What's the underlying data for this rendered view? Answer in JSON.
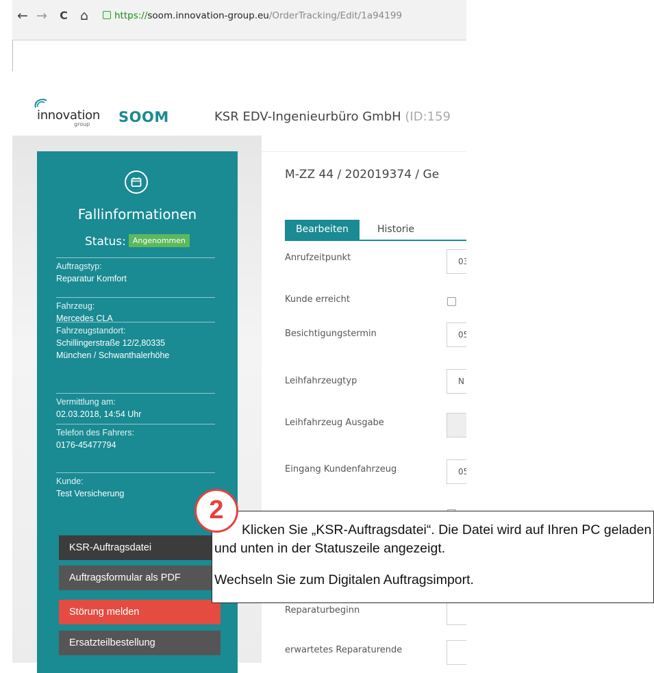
{
  "browser": {
    "url_protocol": "https://",
    "url_host": "soom.innovation-group.eu",
    "url_path": "/OrderTracking/Edit/1a94199",
    "back_icon": "←",
    "forward_icon": "→",
    "reload_icon": "C",
    "home_icon": "⌂"
  },
  "header": {
    "logo_word": "innovation",
    "logo_sub": "group",
    "app_name": "SOOM",
    "company": "KSR EDV-Ingenieurbüro GmbH ",
    "company_id": "(ID:159"
  },
  "sidebar": {
    "title": "Fallinformationen",
    "status_label": "Status:",
    "status_value": "Angenommen",
    "info": [
      {
        "label": "Auftragstyp:",
        "value": "Reparatur Komfort"
      },
      {
        "label": "Fahrzeug:",
        "value": "Mercedes CLA"
      },
      {
        "label": "Fahrzeugstandort:",
        "value": "Schillingerstraße 12/2,80335",
        "value2": "München / Schwanthalerhöhe"
      },
      {
        "label": "Vermittlung am:",
        "value": "02.03.2018, 14:54 Uhr"
      },
      {
        "label": "Telefon des Fahrers:",
        "value": "0176-45477794"
      },
      {
        "label": "Kunde:",
        "value": "Test Versicherung"
      }
    ],
    "buttons": [
      {
        "label": "KSR-Auftragsdatei",
        "color": "#3c3c3c"
      },
      {
        "label": "Auftragsformular als PDF",
        "color": "#555555"
      },
      {
        "label": "Störung melden",
        "color": "#e44c41"
      },
      {
        "label": "Ersatzteilbestellung",
        "color": "#555555"
      }
    ]
  },
  "main": {
    "case_title": "M-ZZ 44 / 202019374 / Ge",
    "tabs": [
      {
        "label": "Bearbeiten"
      },
      {
        "label": "Historie"
      }
    ],
    "fields": [
      {
        "label": "Anrufzeitpunkt",
        "value": "03"
      },
      {
        "label": "Kunde erreicht"
      },
      {
        "label": "Besichtigungstermin",
        "value": "05"
      },
      {
        "label": "Leihfahrzeugtyp",
        "value": "N"
      },
      {
        "label": "Leihfahrzeug Ausgabe",
        "value": ""
      },
      {
        "label": "Eingang Kundenfahrzeug",
        "value": "05"
      },
      {
        "label": "Reparaturbeginn",
        "value": ""
      },
      {
        "label": "erwartetes Reparaturende",
        "value": ""
      }
    ]
  },
  "callout": {
    "step": "2",
    "text1": "Klicken Sie „KSR-Auftragsdatei“. Die Datei wird auf Ihren PC geladen und unten in der Statuszeile angezeigt.",
    "text2": "Wechseln Sie zum Digitalen Auftragsimport.",
    "accent": "#e8403b"
  },
  "colors": {
    "teal": "#1a8a93",
    "status_green": "#5cb85c"
  }
}
